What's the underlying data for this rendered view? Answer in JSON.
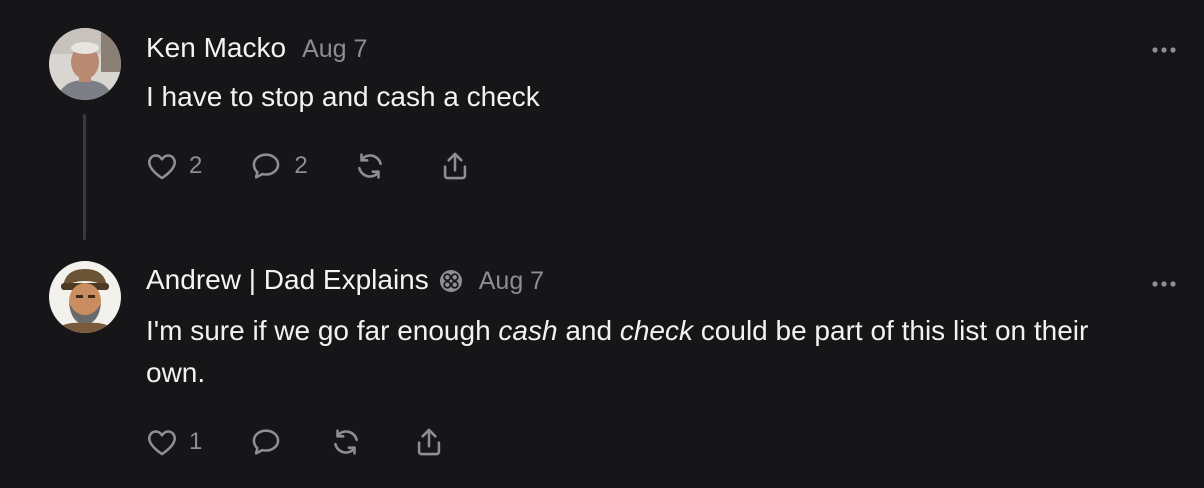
{
  "comments": [
    {
      "author": "Ken Macko",
      "date": "Aug 7",
      "text": "I have to stop and cash a check",
      "likes": "2",
      "replies": "2",
      "icons": {
        "like": "heart-icon",
        "reply": "comment-icon",
        "restack": "restack-icon",
        "share": "share-icon",
        "more": "more-icon"
      }
    },
    {
      "author": "Andrew | Dad Explains",
      "date": "Aug 7",
      "text_parts": {
        "p1": "I'm sure if we go far enough ",
        "em1": "cash",
        "p2": " and ",
        "em2": "check",
        "p3": " could be part of this list on their own."
      },
      "likes": "1",
      "icons": {
        "badge": "subscriber-badge-icon",
        "like": "heart-icon",
        "reply": "comment-icon",
        "restack": "restack-icon",
        "share": "share-icon",
        "more": "more-icon"
      }
    }
  ],
  "colors": {
    "background": "#161618",
    "text_primary": "#f2f2f2",
    "text_secondary": "#8d8d92",
    "thread_line": "#3a3a3c"
  }
}
